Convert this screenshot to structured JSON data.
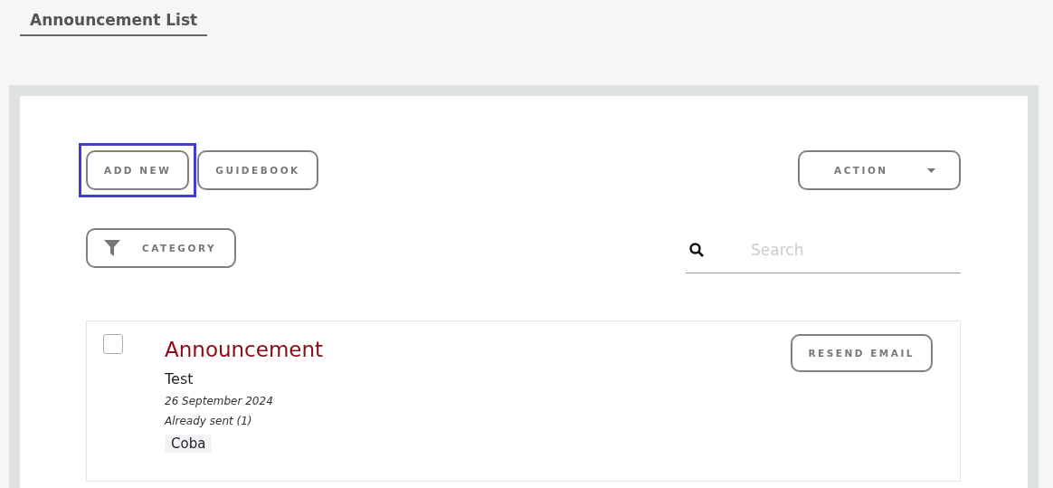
{
  "page_tab": {
    "label": "Announcement List",
    "selected": true
  },
  "toolbar": {
    "buttons": [
      {
        "label": "ADD NEW",
        "focused": true
      },
      {
        "label": "GUIDEBOOK",
        "focused": false
      }
    ],
    "action": {
      "label": "ACTION"
    }
  },
  "filter": {
    "label": "CATEGORY"
  },
  "search": {
    "placeholder": "Search"
  },
  "announcements": [
    {
      "title": "Announcement",
      "body": "Test",
      "date": "26 September 2024",
      "status": "Already sent (1)",
      "tag": "Coba",
      "checked": false,
      "button": "RESEND EMAIL"
    }
  ]
}
